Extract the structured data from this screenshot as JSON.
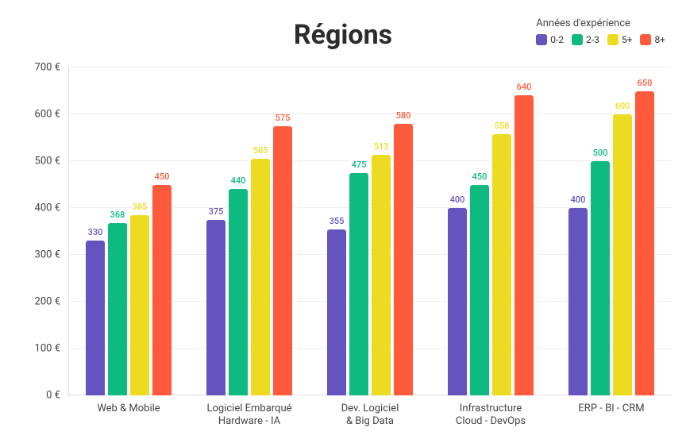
{
  "chart_data": {
    "type": "bar",
    "title": "Régions",
    "legend_title": "Années d'expérience",
    "ylabel": "",
    "xlabel": "",
    "y_ticks": [
      0,
      100,
      200,
      300,
      400,
      500,
      600,
      700
    ],
    "y_tick_suffix": " €",
    "ylim": [
      0,
      700
    ],
    "categories": [
      "Web & Mobile",
      "Logiciel Embarqué Hardware - IA",
      "Dev. Logiciel & Big Data",
      "Infrastructure Cloud - DevOps",
      "ERP - BI - CRM"
    ],
    "category_lines": [
      [
        "Web & Mobile"
      ],
      [
        "Logiciel Embarqué",
        "Hardware - IA"
      ],
      [
        "Dev. Logiciel",
        "& Big Data"
      ],
      [
        "Infrastructure",
        "Cloud - DevOps"
      ],
      [
        "ERP - BI - CRM"
      ]
    ],
    "series": [
      {
        "name": "0-2",
        "color": "#6554c0",
        "values": [
          330,
          375,
          355,
          400,
          400
        ]
      },
      {
        "name": "2-3",
        "color": "#0fba81",
        "values": [
          368,
          440,
          475,
          450,
          500
        ]
      },
      {
        "name": "5+",
        "color": "#ecdb21",
        "values": [
          385,
          505,
          513,
          558,
          600
        ]
      },
      {
        "name": "8+",
        "color": "#ff5a3c",
        "values": [
          450,
          575,
          580,
          640,
          650
        ]
      }
    ]
  }
}
